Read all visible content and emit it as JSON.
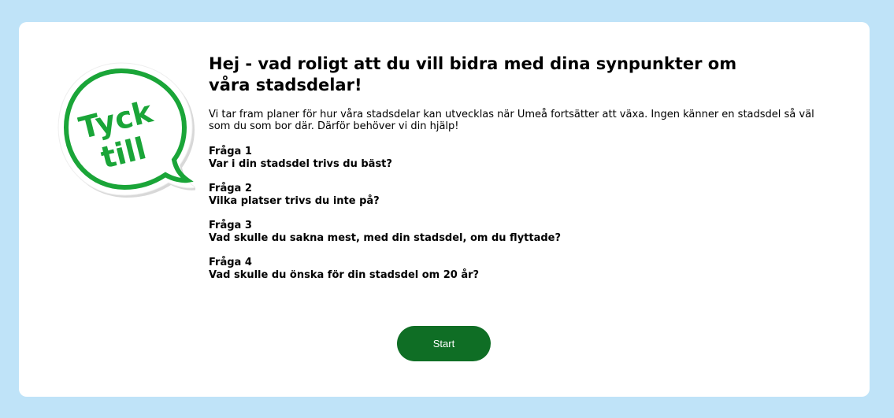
{
  "logo": {
    "line1": "Tyck",
    "line2": "till",
    "color": "#1aa538"
  },
  "title": "Hej - vad roligt att du vill bidra med dina synpunkter om våra stadsdelar!",
  "intro": "Vi tar fram planer för hur våra stadsdelar kan utvecklas när Umeå fortsätter att växa. Ingen känner en stadsdel så väl som du som bor där. Därför behöver vi din hjälp!",
  "questions": [
    {
      "label": "Fråga 1",
      "text": "Var i din stadsdel trivs du bäst?"
    },
    {
      "label": "Fråga 2",
      "text": "Vilka platser trivs du inte på?"
    },
    {
      "label": "Fråga 3",
      "text": "Vad skulle du sakna mest, med din stadsdel, om du flyttade?"
    },
    {
      "label": "Fråga 4",
      "text": "Vad skulle du önska för din stadsdel om 20 år?"
    }
  ],
  "start_button": {
    "label": "Start",
    "color": "#0f6e25"
  },
  "colors": {
    "background": "#bfe3f8",
    "card": "#ffffff"
  }
}
